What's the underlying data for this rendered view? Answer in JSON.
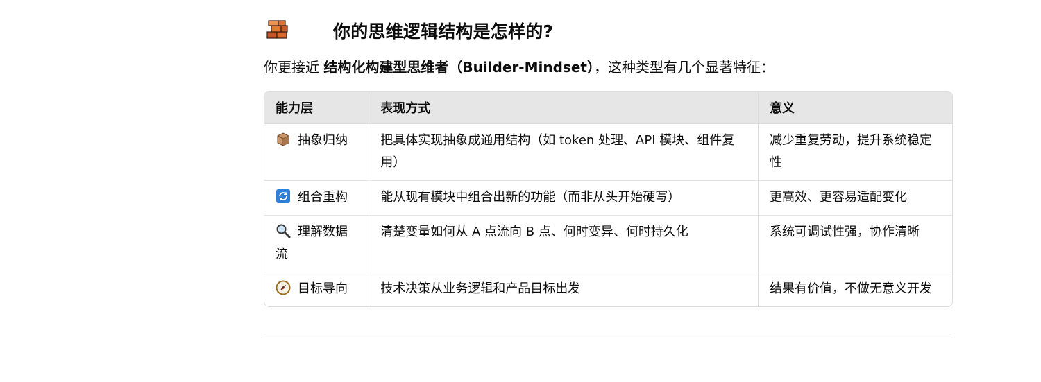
{
  "section": {
    "icon": "bricks-icon",
    "title": "你的思维逻辑结构是怎样的?"
  },
  "intro": {
    "prefix": "你更接近 ",
    "bold": "结构化构建型思维者（Builder-Mindset）",
    "suffix": "，这种类型有几个显著特征："
  },
  "table": {
    "headers": [
      "能力层",
      "表现方式",
      "意义"
    ],
    "rows": [
      {
        "icon": "package-icon",
        "layer": "抽象归纳",
        "behavior": "把具体实现抽象成通用结构（如 token 处理、API 模块、组件复用）",
        "meaning": "减少重复劳动，提升系统稳定性"
      },
      {
        "icon": "refresh-icon",
        "layer": "组合重构",
        "behavior": "能从现有模块中组合出新的功能（而非从头开始硬写）",
        "meaning": "更高效、更容易适配变化"
      },
      {
        "icon": "magnifier-icon",
        "layer": "理解数据流",
        "behavior": "清楚变量如何从 A 点流向 B 点、何时变异、何时持久化",
        "meaning": "系统可调试性强，协作清晰"
      },
      {
        "icon": "compass-icon",
        "layer": "目标导向",
        "behavior": "技术决策从业务逻辑和产品目标出发",
        "meaning": "结果有价值，不做无意义开发"
      }
    ]
  }
}
